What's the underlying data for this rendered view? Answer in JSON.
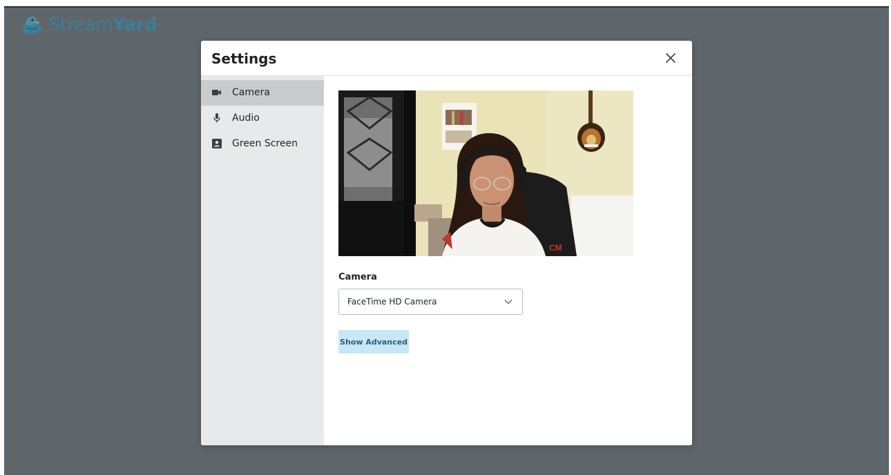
{
  "app": {
    "logo_text_light": "Stream",
    "logo_text_bold": "Yard",
    "logo_icon": "duck-logo-icon",
    "brand_color": "#3b7f99"
  },
  "modal": {
    "title": "Settings",
    "close_icon": "close-icon"
  },
  "sidebar": {
    "items": [
      {
        "label": "Camera",
        "icon": "video-camera-icon",
        "active": true
      },
      {
        "label": "Audio",
        "icon": "microphone-icon",
        "active": false
      },
      {
        "label": "Green Screen",
        "icon": "contact-card-icon",
        "active": false
      }
    ]
  },
  "camera_panel": {
    "preview_icon": "camera-preview-image",
    "camera_label": "Camera",
    "selected_camera": "FaceTime HD Camera",
    "advanced_button": "Show Advanced",
    "advanced_button_color": "#c8e6f5"
  }
}
